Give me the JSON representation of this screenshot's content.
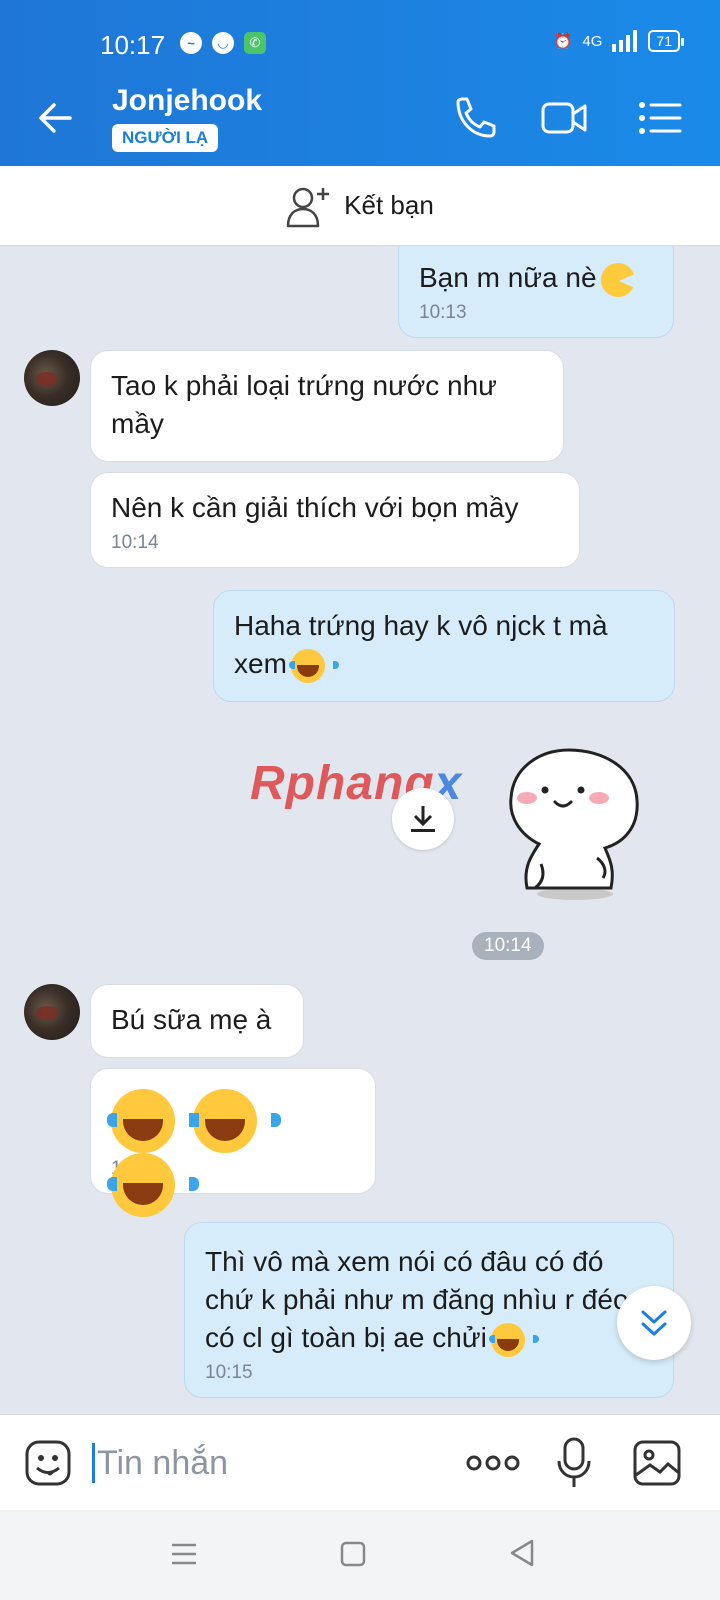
{
  "status": {
    "time": "10:17",
    "network": "4G",
    "battery": "71"
  },
  "header": {
    "contact_name": "Jonjehook",
    "badge": "NGƯỜI LẠ"
  },
  "add_friend": {
    "label": "Kết bạn"
  },
  "messages": [
    {
      "from": "me",
      "text": "Bạn m nữa nè",
      "time": "10:13"
    },
    {
      "from": "them",
      "text": "Tao k phải loại trứng nước như mầy"
    },
    {
      "from": "them",
      "text": "Nên k cần giải thích với bọn mầy",
      "time": "10:14"
    },
    {
      "from": "me",
      "text": "Haha trứng hay k vô njck t mà xem"
    },
    {
      "from": "me",
      "type": "sticker",
      "time": "10:14"
    },
    {
      "from": "them",
      "text": "Bú sữa mẹ à"
    },
    {
      "from": "them",
      "type": "emoji",
      "time": "10:14"
    },
    {
      "from": "me",
      "text": "Thì vô mà xem nói có đâu có đó chứ k phải như m đăng nhìu r đéo có cl gì toàn bị ae chửi",
      "time": "10:15"
    }
  ],
  "watermark": {
    "part1": "Rphang",
    "part2": "x"
  },
  "input": {
    "placeholder": "Tin nhắn"
  },
  "colors": {
    "header": "#1a7fe0",
    "my_bubble": "#d6ecfb",
    "background": "#e2e7ef"
  }
}
